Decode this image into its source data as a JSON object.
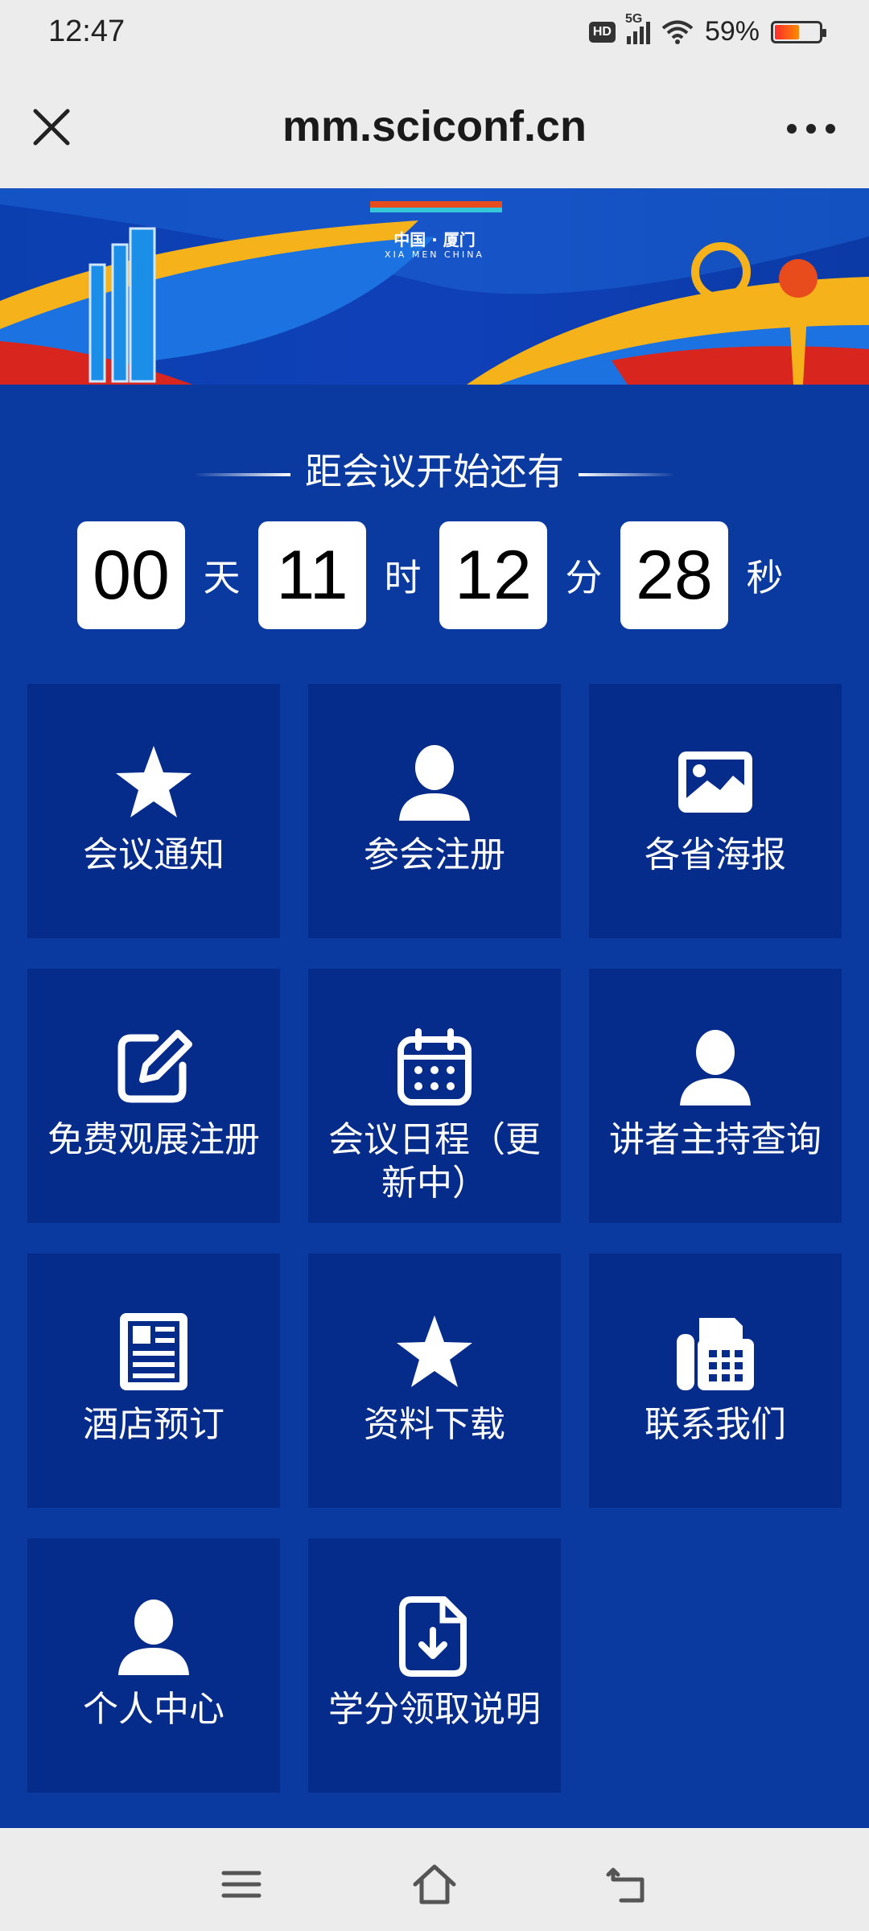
{
  "status_bar": {
    "time": "12:47",
    "hd_badge": "HD",
    "network": "5G",
    "battery_percent": "59%",
    "battery_level": 0.59
  },
  "navbar": {
    "title": "mm.sciconf.cn",
    "close_icon": "close-icon",
    "more_icon": "more-icon"
  },
  "banner": {
    "caption": "中国 · 厦门",
    "caption_en": "XIA MEN CHINA"
  },
  "countdown": {
    "title": "距会议开始还有",
    "days": "00",
    "days_unit": "天",
    "hours": "11",
    "hours_unit": "时",
    "minutes": "12",
    "minutes_unit": "分",
    "seconds": "28",
    "seconds_unit": "秒"
  },
  "menu": [
    {
      "label": "会议通知",
      "icon": "star-icon"
    },
    {
      "label": "参会注册",
      "icon": "user-icon"
    },
    {
      "label": "各省海报",
      "icon": "image-icon"
    },
    {
      "label": "免费观展注册",
      "icon": "edit-icon"
    },
    {
      "label": "会议日程（更新中）",
      "icon": "calendar-icon"
    },
    {
      "label": "讲者主持查询",
      "icon": "user-icon"
    },
    {
      "label": "酒店预订",
      "icon": "newspaper-icon"
    },
    {
      "label": "资料下载",
      "icon": "star-icon"
    },
    {
      "label": "联系我们",
      "icon": "fax-icon"
    },
    {
      "label": "个人中心",
      "icon": "user-icon"
    },
    {
      "label": "学分领取说明",
      "icon": "file-download-icon"
    }
  ],
  "system_nav": {
    "menu_icon": "menu-icon",
    "home_icon": "home-icon",
    "back_icon": "back-icon"
  },
  "colors": {
    "background": "#0a3a9f",
    "tile": "#052c8a",
    "bar": "#ececec"
  }
}
